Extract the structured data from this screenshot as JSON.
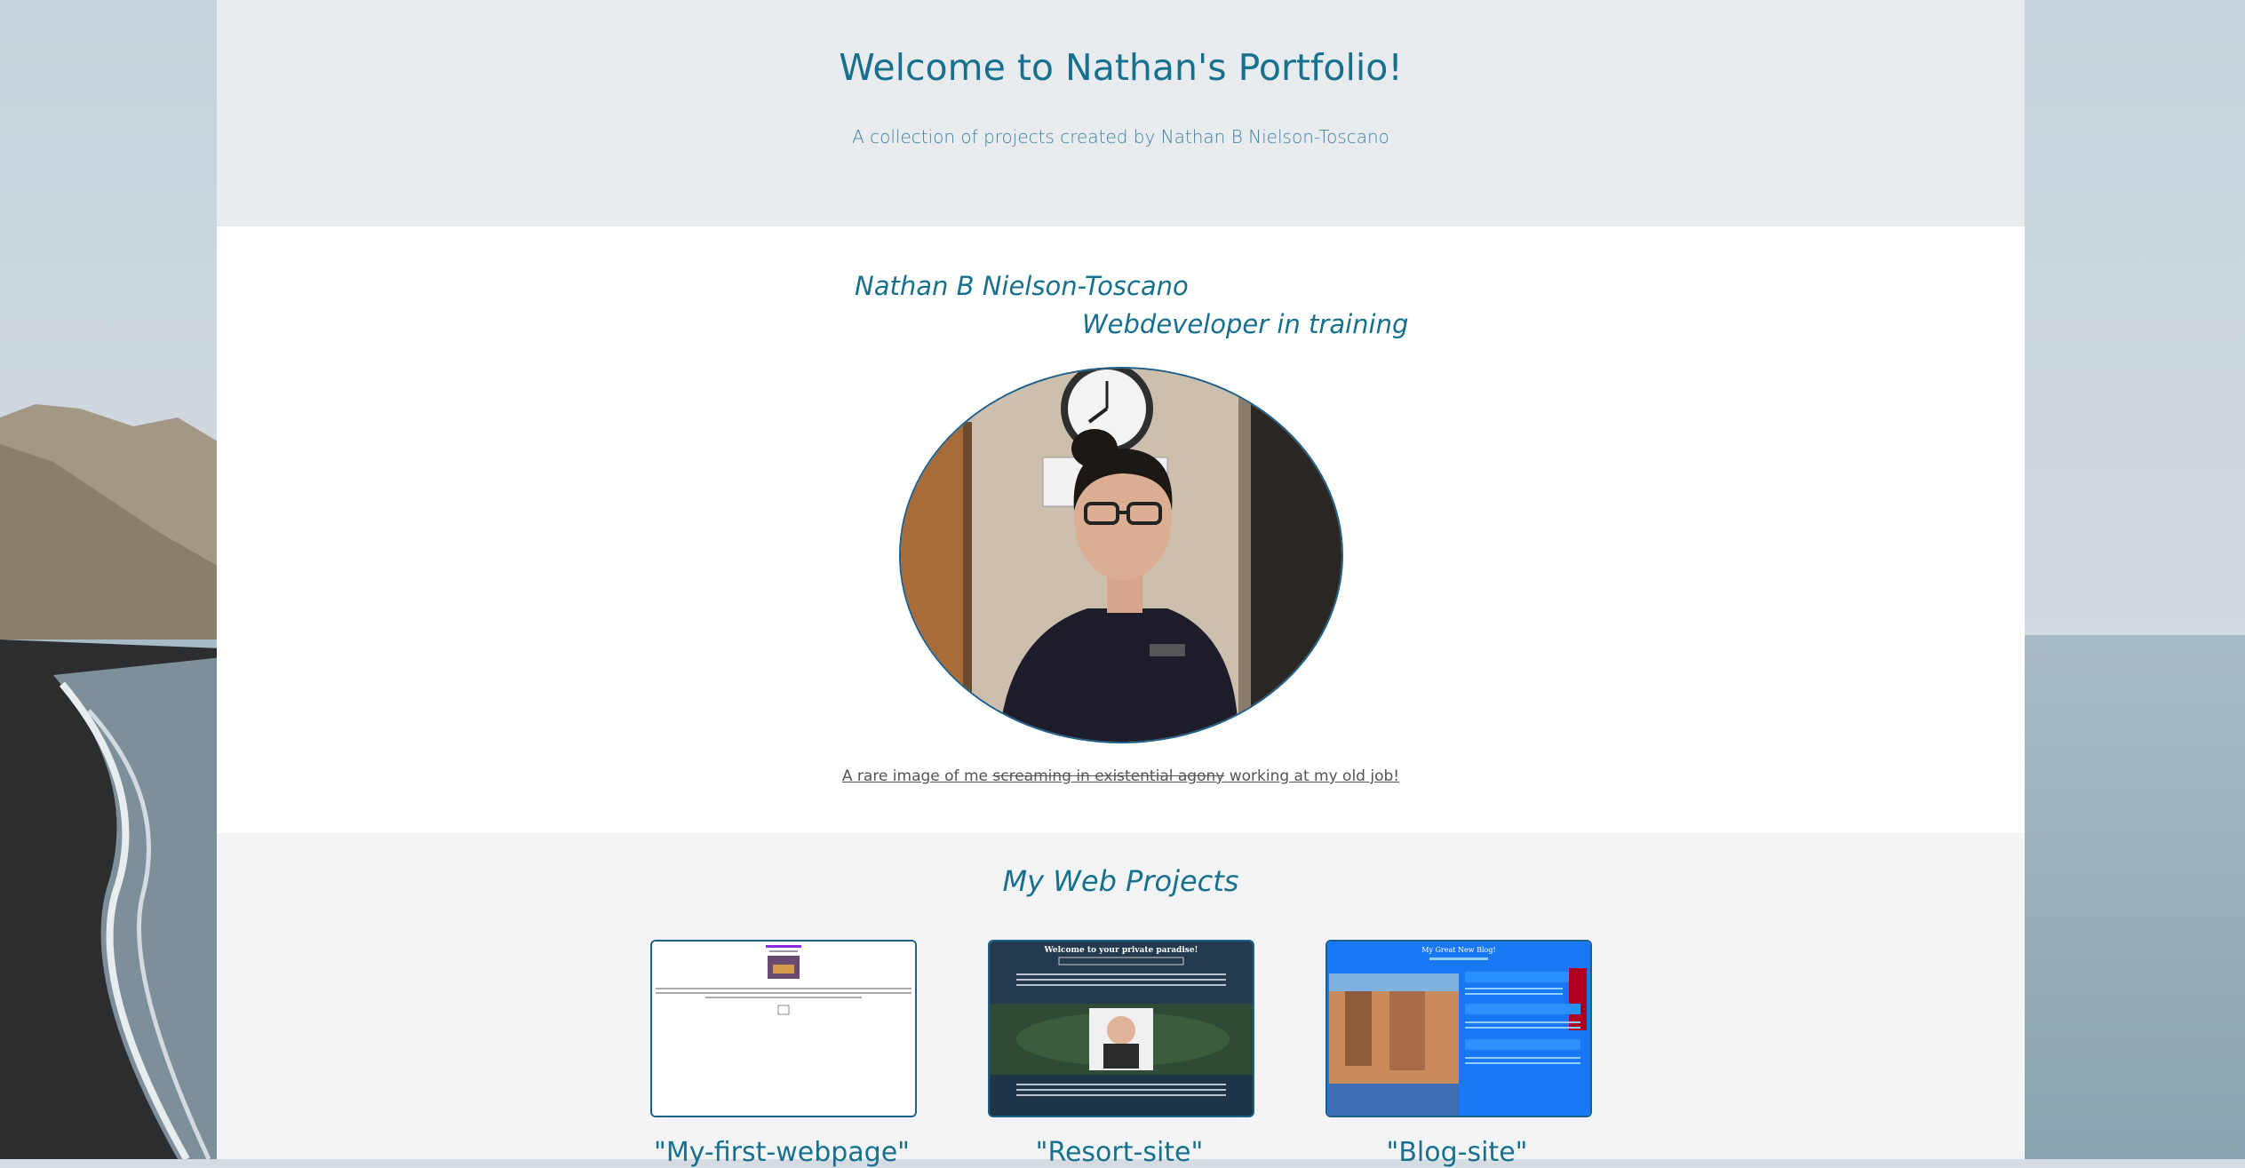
{
  "header": {
    "title": "Welcome to Nathan's Portfolio!",
    "subtitle": "A collection of projects created by Nathan B Nielson-Toscano"
  },
  "about": {
    "name": "Nathan B Nielson-Toscano",
    "role": "Webdeveloper in training",
    "caption_before": "A rare image of me ",
    "caption_strike": "screaming in existential agony",
    "caption_after": " working at my old job!"
  },
  "projects": {
    "heading": "My Web Projects",
    "items": [
      {
        "title": "\"My-first-webpage\""
      },
      {
        "title": "\"Resort-site\""
      },
      {
        "title": "\"Blog-site\"",
        "thumb_heading": "My Great New Blog!"
      }
    ],
    "resort_thumb_heading": "Welcome to your private paradise!"
  },
  "colors": {
    "accent": "#16708e",
    "header_bg": "#e8ecef",
    "projects_bg": "#f3f4f5",
    "blog_blue": "#1877f2"
  }
}
